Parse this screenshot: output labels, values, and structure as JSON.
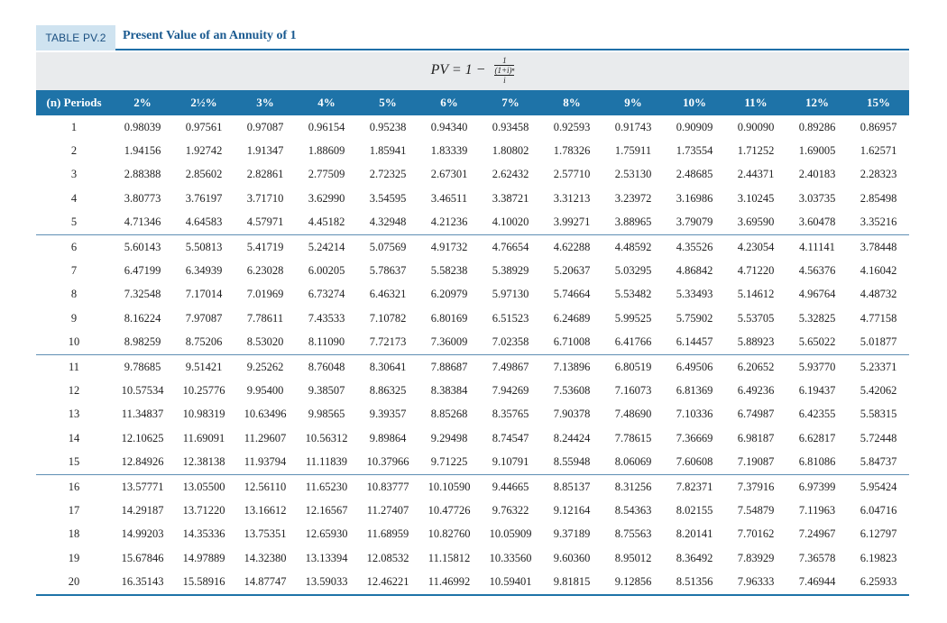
{
  "header": {
    "tag": "TABLE PV.2",
    "title": "Present Value of an Annuity of 1"
  },
  "formula": {
    "lhs": "PV = 1 −",
    "numerator": "1",
    "inner": "(1+i)ⁿ",
    "denominator": "i"
  },
  "columns": [
    "(n) Periods",
    "2%",
    "2½%",
    "3%",
    "4%",
    "5%",
    "6%",
    "7%",
    "8%",
    "9%",
    "10%",
    "11%",
    "12%",
    "15%"
  ],
  "rows": [
    [
      "1",
      "0.98039",
      "0.97561",
      "0.97087",
      "0.96154",
      "0.95238",
      "0.94340",
      "0.93458",
      "0.92593",
      "0.91743",
      "0.90909",
      "0.90090",
      "0.89286",
      "0.86957"
    ],
    [
      "2",
      "1.94156",
      "1.92742",
      "1.91347",
      "1.88609",
      "1.85941",
      "1.83339",
      "1.80802",
      "1.78326",
      "1.75911",
      "1.73554",
      "1.71252",
      "1.69005",
      "1.62571"
    ],
    [
      "3",
      "2.88388",
      "2.85602",
      "2.82861",
      "2.77509",
      "2.72325",
      "2.67301",
      "2.62432",
      "2.57710",
      "2.53130",
      "2.48685",
      "2.44371",
      "2.40183",
      "2.28323"
    ],
    [
      "4",
      "3.80773",
      "3.76197",
      "3.71710",
      "3.62990",
      "3.54595",
      "3.46511",
      "3.38721",
      "3.31213",
      "3.23972",
      "3.16986",
      "3.10245",
      "3.03735",
      "2.85498"
    ],
    [
      "5",
      "4.71346",
      "4.64583",
      "4.57971",
      "4.45182",
      "4.32948",
      "4.21236",
      "4.10020",
      "3.99271",
      "3.88965",
      "3.79079",
      "3.69590",
      "3.60478",
      "3.35216"
    ],
    [
      "6",
      "5.60143",
      "5.50813",
      "5.41719",
      "5.24214",
      "5.07569",
      "4.91732",
      "4.76654",
      "4.62288",
      "4.48592",
      "4.35526",
      "4.23054",
      "4.11141",
      "3.78448"
    ],
    [
      "7",
      "6.47199",
      "6.34939",
      "6.23028",
      "6.00205",
      "5.78637",
      "5.58238",
      "5.38929",
      "5.20637",
      "5.03295",
      "4.86842",
      "4.71220",
      "4.56376",
      "4.16042"
    ],
    [
      "8",
      "7.32548",
      "7.17014",
      "7.01969",
      "6.73274",
      "6.46321",
      "6.20979",
      "5.97130",
      "5.74664",
      "5.53482",
      "5.33493",
      "5.14612",
      "4.96764",
      "4.48732"
    ],
    [
      "9",
      "8.16224",
      "7.97087",
      "7.78611",
      "7.43533",
      "7.10782",
      "6.80169",
      "6.51523",
      "6.24689",
      "5.99525",
      "5.75902",
      "5.53705",
      "5.32825",
      "4.77158"
    ],
    [
      "10",
      "8.98259",
      "8.75206",
      "8.53020",
      "8.11090",
      "7.72173",
      "7.36009",
      "7.02358",
      "6.71008",
      "6.41766",
      "6.14457",
      "5.88923",
      "5.65022",
      "5.01877"
    ],
    [
      "11",
      "9.78685",
      "9.51421",
      "9.25262",
      "8.76048",
      "8.30641",
      "7.88687",
      "7.49867",
      "7.13896",
      "6.80519",
      "6.49506",
      "6.20652",
      "5.93770",
      "5.23371"
    ],
    [
      "12",
      "10.57534",
      "10.25776",
      "9.95400",
      "9.38507",
      "8.86325",
      "8.38384",
      "7.94269",
      "7.53608",
      "7.16073",
      "6.81369",
      "6.49236",
      "6.19437",
      "5.42062"
    ],
    [
      "13",
      "11.34837",
      "10.98319",
      "10.63496",
      "9.98565",
      "9.39357",
      "8.85268",
      "8.35765",
      "7.90378",
      "7.48690",
      "7.10336",
      "6.74987",
      "6.42355",
      "5.58315"
    ],
    [
      "14",
      "12.10625",
      "11.69091",
      "11.29607",
      "10.56312",
      "9.89864",
      "9.29498",
      "8.74547",
      "8.24424",
      "7.78615",
      "7.36669",
      "6.98187",
      "6.62817",
      "5.72448"
    ],
    [
      "15",
      "12.84926",
      "12.38138",
      "11.93794",
      "11.11839",
      "10.37966",
      "9.71225",
      "9.10791",
      "8.55948",
      "8.06069",
      "7.60608",
      "7.19087",
      "6.81086",
      "5.84737"
    ],
    [
      "16",
      "13.57771",
      "13.05500",
      "12.56110",
      "11.65230",
      "10.83777",
      "10.10590",
      "9.44665",
      "8.85137",
      "8.31256",
      "7.82371",
      "7.37916",
      "6.97399",
      "5.95424"
    ],
    [
      "17",
      "14.29187",
      "13.71220",
      "13.16612",
      "12.16567",
      "11.27407",
      "10.47726",
      "9.76322",
      "9.12164",
      "8.54363",
      "8.02155",
      "7.54879",
      "7.11963",
      "6.04716"
    ],
    [
      "18",
      "14.99203",
      "14.35336",
      "13.75351",
      "12.65930",
      "11.68959",
      "10.82760",
      "10.05909",
      "9.37189",
      "8.75563",
      "8.20141",
      "7.70162",
      "7.24967",
      "6.12797"
    ],
    [
      "19",
      "15.67846",
      "14.97889",
      "14.32380",
      "13.13394",
      "12.08532",
      "11.15812",
      "10.33560",
      "9.60360",
      "8.95012",
      "8.36492",
      "7.83929",
      "7.36578",
      "6.19823"
    ],
    [
      "20",
      "16.35143",
      "15.58916",
      "14.87747",
      "13.59033",
      "12.46221",
      "11.46992",
      "10.59401",
      "9.81815",
      "9.12856",
      "8.51356",
      "7.96333",
      "7.46944",
      "6.25933"
    ]
  ],
  "colors": {
    "header_bg": "#1e73a8",
    "tag_bg": "#cfe3f0",
    "title_color": "#1a5a90",
    "formula_band": "#e9ebed"
  }
}
